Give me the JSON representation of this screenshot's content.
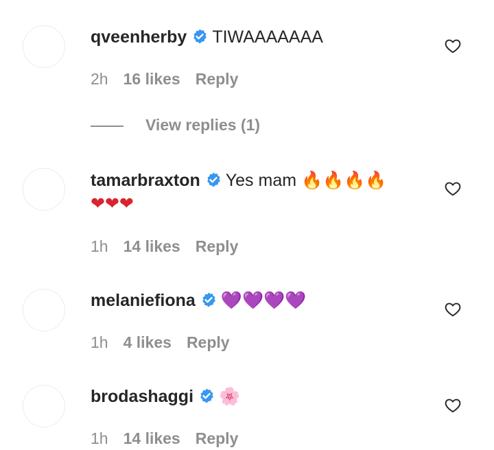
{
  "comments": [
    {
      "username": "qveenherby",
      "text": "TIWAAAAAAA",
      "time": "2h",
      "likes": "16 likes",
      "reply": "Reply",
      "view_replies": "View replies (1)"
    },
    {
      "username": "tamarbraxton",
      "text": "Yes mam",
      "emoji_line1": "🔥🔥🔥🔥",
      "emoji_line2": "❤❤❤",
      "time": "1h",
      "likes": "14 likes",
      "reply": "Reply"
    },
    {
      "username": "melaniefiona",
      "text": "💜💜💜💜",
      "time": "1h",
      "likes": "4 likes",
      "reply": "Reply"
    },
    {
      "username": "brodashaggi",
      "text": "🌸",
      "time": "1h",
      "likes": "14 likes",
      "reply": "Reply"
    }
  ],
  "colors": {
    "verified": "#3897f0",
    "text": "#262626",
    "meta": "#8e8e8e"
  },
  "icons": {
    "verified": "verified-badge-icon",
    "like": "heart-outline-icon"
  }
}
